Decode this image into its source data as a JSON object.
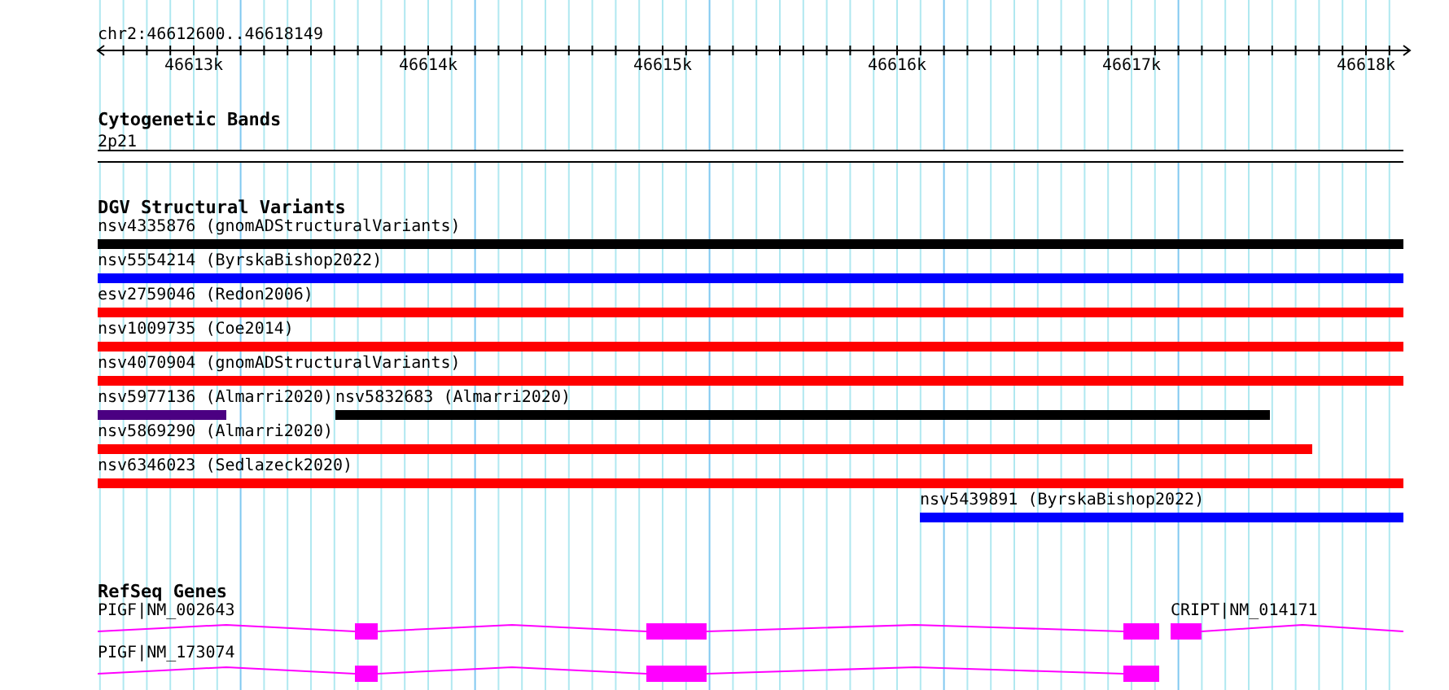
{
  "location": "chr2:46612600..46618149",
  "ruler": {
    "labels": [
      "46613k",
      "46614k",
      "46615k",
      "46616k",
      "46617k",
      "46618k"
    ]
  },
  "tracks": [
    {
      "kind": "bands",
      "title": "Cytogenetic Bands",
      "label": "2p21"
    },
    {
      "kind": "variants",
      "title": "DGV Structural Variants",
      "rows": [
        [
          {
            "label": "nsv4335876 (gnomADStructuralVariants)",
            "color": "#000000"
          }
        ],
        [
          {
            "label": "nsv5554214 (ByrskaBishop2022)",
            "color": "#0000ff"
          }
        ],
        [
          {
            "label": "esv2759046 (Redon2006)",
            "color": "#ff0000"
          }
        ],
        [
          {
            "label": "nsv1009735 (Coe2014)",
            "color": "#ff0000"
          }
        ],
        [
          {
            "label": "nsv4070904 (gnomADStructuralVariants)",
            "color": "#ff0000"
          }
        ],
        [
          {
            "label": "nsv5977136 (Almarri2020)",
            "color": "#4b0082"
          },
          {
            "label": "nsv5832683 (Almarri2020)",
            "color": "#000000"
          }
        ],
        [
          {
            "label": "nsv5869290 (Almarri2020)",
            "color": "#ff0000"
          }
        ],
        [
          {
            "label": "nsv6346023 (Sedlazeck2020)",
            "color": "#ff0000"
          }
        ],
        [
          {
            "label": "nsv5439891 (ByrskaBishop2022)",
            "color": "#0000ff"
          }
        ]
      ]
    },
    {
      "kind": "genes",
      "title": "RefSeq Genes",
      "rows": [
        [
          {
            "label": "PIGF|NM_002643"
          },
          {
            "label": "CRIPT|NM_014171"
          }
        ],
        [
          {
            "label": "PIGF|NM_173074"
          }
        ]
      ]
    }
  ]
}
